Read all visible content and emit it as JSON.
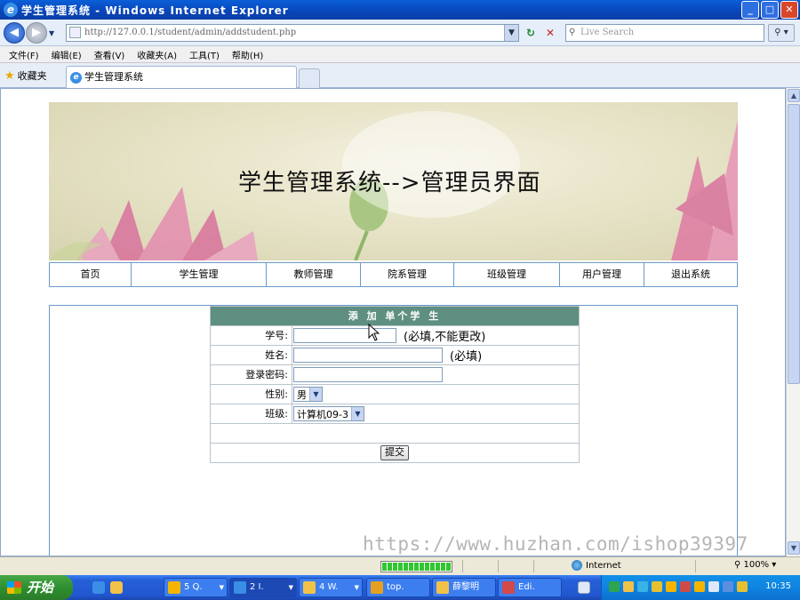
{
  "window": {
    "title": "学生管理系统 - Windows Internet Explorer",
    "buttons": {
      "minimize": "_",
      "maximize": "□",
      "close": "✕"
    }
  },
  "address_bar": {
    "url": "http://127.0.0.1/student/admin/addstudent.php",
    "search_placeholder": "Live Search"
  },
  "menu": [
    "文件(F)",
    "编辑(E)",
    "查看(V)",
    "收藏夹(A)",
    "工具(T)",
    "帮助(H)"
  ],
  "favorites": {
    "label": "收藏夹"
  },
  "tab": {
    "title": "学生管理系统"
  },
  "page": {
    "banner_title": "学生管理系统-->管理员界面",
    "nav": [
      "首页",
      "学生管理",
      "教师管理",
      "院系管理",
      "班级管理",
      "用户管理",
      "退出系统"
    ],
    "form": {
      "header": "添 加 单个学 生",
      "fields": [
        {
          "label": "学号:",
          "value": "",
          "hint": "(必填,不能更改)"
        },
        {
          "label": "姓名:",
          "value": "",
          "hint": "(必填)"
        },
        {
          "label": "登录密码:",
          "value": "",
          "hint": ""
        }
      ],
      "gender": {
        "label": "性别:",
        "selected": "男"
      },
      "class": {
        "label": "班级:",
        "selected": "计算机09-3"
      },
      "submit_label": "提交"
    },
    "watermark": "https://www.huzhan.com/ishop39397"
  },
  "status_bar": {
    "zone": "Internet",
    "zoom": "100%",
    "progress": 1.0
  },
  "taskbar": {
    "start_label": "开始",
    "tasks": [
      "5 Q.",
      "2 I.",
      "4 W.",
      "top.",
      "薛黎明",
      "Edi."
    ],
    "clock": "10:35"
  },
  "icons": {
    "back": "back-arrow-icon",
    "forward": "forward-arrow-icon",
    "refresh": "refresh-icon",
    "stop": "stop-icon",
    "search": "search-icon",
    "favorites": "star-icon",
    "ie": "ie-logo-icon",
    "globe": "globe-icon"
  },
  "colors": {
    "title_bar": "#0845b8",
    "form_header": "#5f8f80",
    "nav_border": "#6a9ac8",
    "taskbar": "#2157d0",
    "start_button": "#2f8f2f"
  }
}
